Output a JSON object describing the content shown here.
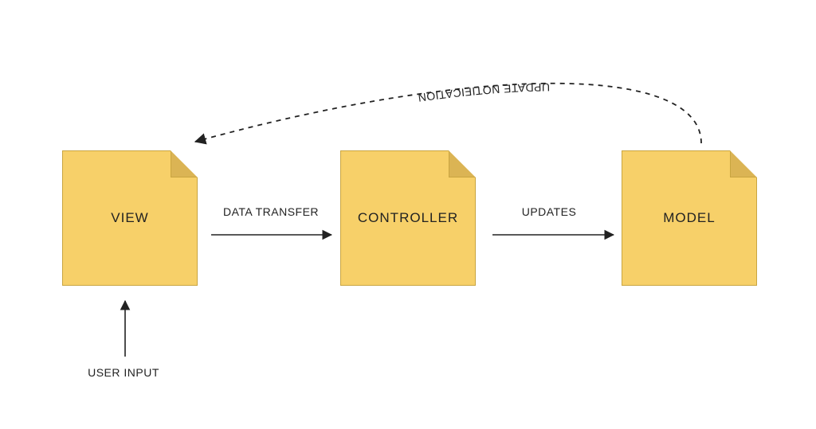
{
  "nodes": {
    "view": {
      "label": "VIEW"
    },
    "controller": {
      "label": "CONTROLLER"
    },
    "model": {
      "label": "MODEL"
    }
  },
  "edges": {
    "data_transfer": {
      "label": "DATA TRANSFER"
    },
    "updates": {
      "label": "UPDATES"
    },
    "user_input": {
      "label": "USER INPUT"
    },
    "update_notification": {
      "label": "UPDATE NOTIFICATION"
    }
  }
}
